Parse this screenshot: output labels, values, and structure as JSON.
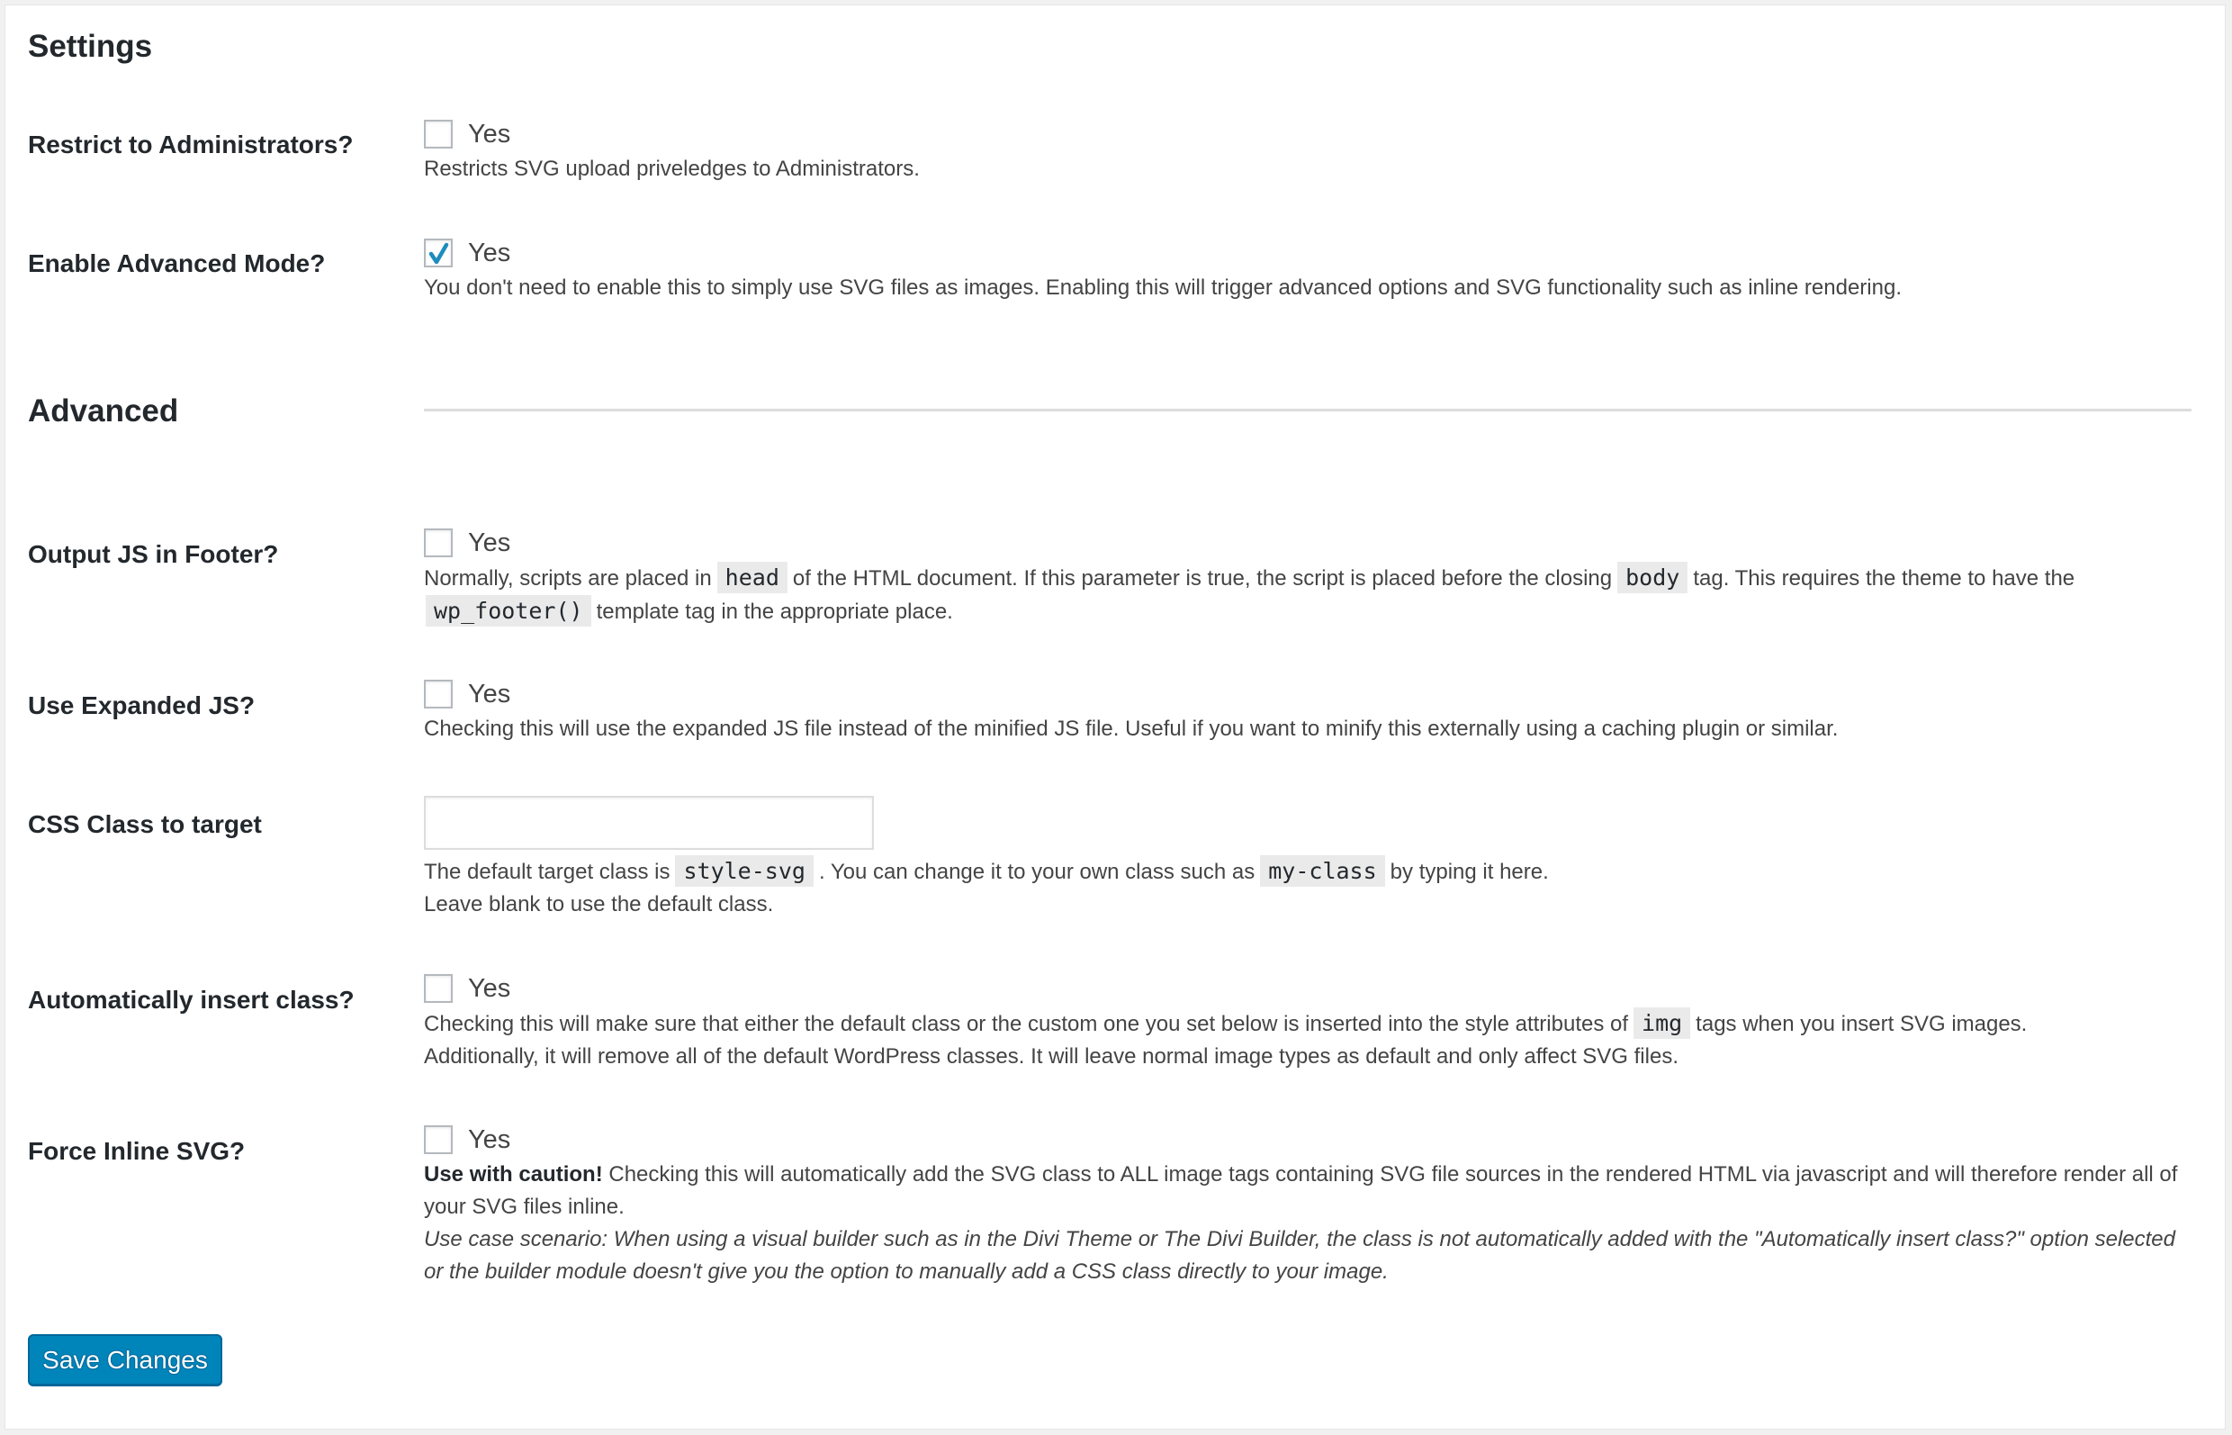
{
  "settings": {
    "heading": "Settings",
    "restrict": {
      "label": "Restrict to Administrators?",
      "checkbox_label": "Yes",
      "checked": false,
      "description": "Restricts SVG upload priveledges to Administrators."
    },
    "advanced_mode": {
      "label": "Enable Advanced Mode?",
      "checkbox_label": "Yes",
      "checked": true,
      "description": "You don't need to enable this to simply use SVG files as images. Enabling this will trigger advanced options and SVG functionality such as inline rendering."
    }
  },
  "advanced": {
    "heading": "Advanced",
    "js_footer": {
      "label": "Output JS in Footer?",
      "checkbox_label": "Yes",
      "checked": false,
      "desc_1": "Normally, scripts are placed in",
      "code_1": "head",
      "desc_2": "of the HTML document. If this parameter is true, the script is placed before the closing",
      "code_2": "body",
      "desc_3": "tag. This requires the theme to have the",
      "code_3": "wp_footer()",
      "desc_4": "template tag in the appropriate place."
    },
    "expanded_js": {
      "label": "Use Expanded JS?",
      "checkbox_label": "Yes",
      "checked": false,
      "description": "Checking this will use the expanded JS file instead of the minified JS file. Useful if you want to minify this externally using a caching plugin or similar."
    },
    "css_class": {
      "label": "CSS Class to target",
      "value": "",
      "placeholder": "",
      "desc_1": "The default target class is",
      "code_1": "style-svg",
      "desc_2": ". You can change it to your own class such as",
      "code_2": "my-class",
      "desc_3": "by typing it here.",
      "desc_4": "Leave blank to use the default class."
    },
    "auto_insert": {
      "label": "Automatically insert class?",
      "checkbox_label": "Yes",
      "checked": false,
      "desc_1": "Checking this will make sure that either the default class or the custom one you set below is inserted into the style attributes of",
      "code_1": "img",
      "desc_2": "tags when you insert SVG images.",
      "desc_3": "Additionally, it will remove all of the default WordPress classes. It will leave normal image types as default and only affect SVG files."
    },
    "force_inline": {
      "label": "Force Inline SVG?",
      "checkbox_label": "Yes",
      "checked": false,
      "caution": "Use with caution!",
      "desc_1": "Checking this will automatically add the SVG class to ALL image tags containing SVG file sources in the rendered HTML via javascript and will therefore render all of your SVG files inline.",
      "use_case": "Use case scenario: When using a visual builder such as in the Divi Theme or The Divi Builder, the class is not automatically added with the \"Automatically insert class?\" option selected or the builder module doesn't give you the option to manually add a CSS class directly to your image."
    }
  },
  "save_button": "Save Changes",
  "colors": {
    "accent": "#0085ba",
    "check": "#1e8cbe"
  }
}
